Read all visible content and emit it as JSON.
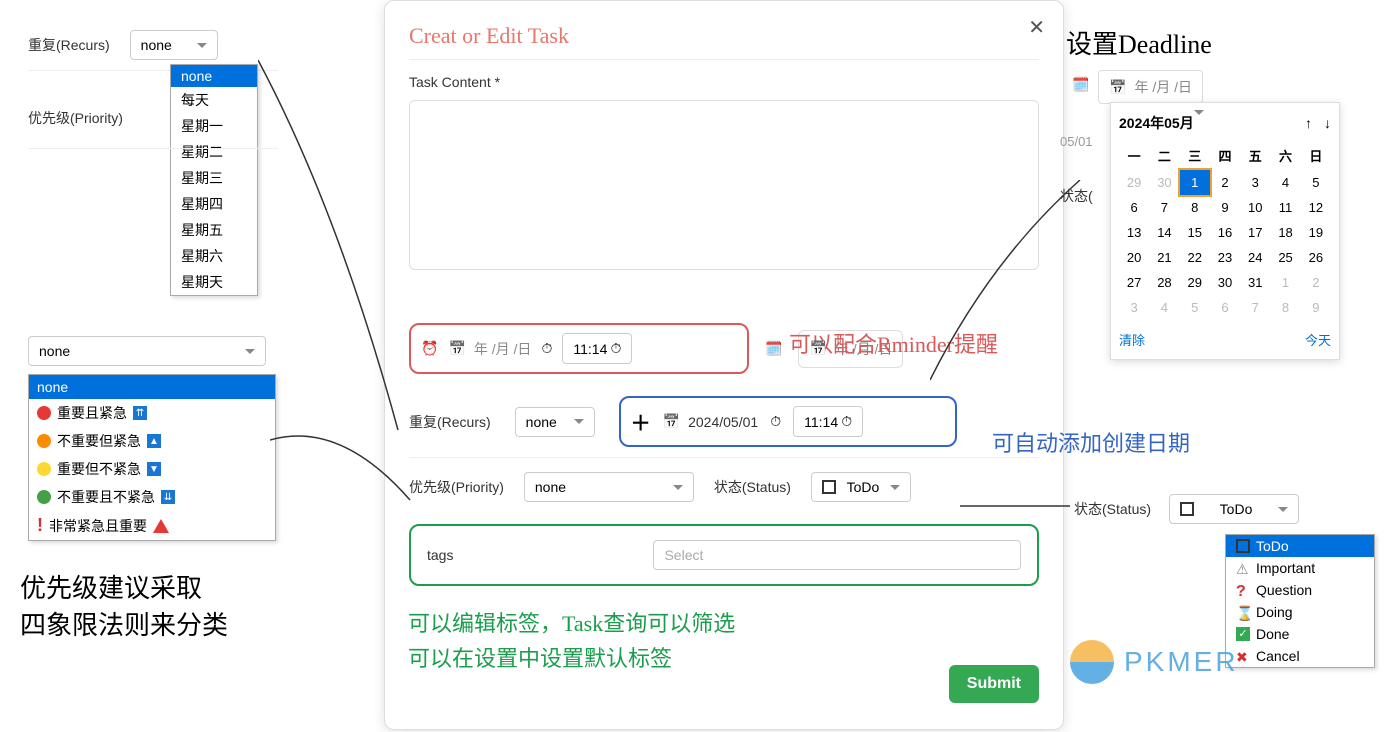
{
  "recurs": {
    "label": "重复(Recurs)",
    "selected": "none",
    "items": [
      "none",
      "每天",
      "星期一",
      "星期二",
      "星期三",
      "星期四",
      "星期五",
      "星期六",
      "星期天"
    ]
  },
  "priority_label_left": "优先级(Priority)",
  "priority": {
    "selected": "none",
    "items": [
      {
        "label": "none"
      },
      {
        "label": "重要且紧急",
        "color": "#e53935",
        "arrow": "⇈"
      },
      {
        "label": "不重要但紧急",
        "color": "#fb8c00",
        "arrow": "▲"
      },
      {
        "label": "重要但不紧急",
        "color": "#fdd835",
        "arrow": "▼"
      },
      {
        "label": "不重要且不紧急",
        "color": "#43a047",
        "arrow": "⇊"
      },
      {
        "label": "非常紧急且重要",
        "color": "",
        "arrow": ""
      }
    ]
  },
  "priority_note_l1": "优先级建议采取",
  "priority_note_l2": "四象限法则来分类",
  "dialog": {
    "title": "Creat or Edit Task",
    "content_label": "Task Content *",
    "reminder": {
      "date_ph": "年 /月 /日",
      "time": "11:14"
    },
    "deadline_inline": {
      "date_ph": "年 /月 /日"
    },
    "recurs": {
      "label": "重复(Recurs)",
      "selected": "none"
    },
    "created": {
      "date": "2024/05/01",
      "time": "11:14"
    },
    "priority": {
      "label": "优先级(Priority)",
      "selected": "none"
    },
    "status": {
      "label": "状态(Status)",
      "selected": "ToDo"
    },
    "tags": {
      "label": "tags",
      "placeholder": "Select"
    },
    "submit": "Submit"
  },
  "annotations": {
    "reminder": "可以配合Rminder提醒",
    "created": "可自动添加创建日期",
    "tags_l1": "可以编辑标签，Task查询可以筛选",
    "tags_l2": "可以在设置中设置默认标签"
  },
  "deadline": {
    "title": "设置Deadline",
    "input_ph": "年 /月 /日",
    "month": "2024年05月",
    "dow": [
      "一",
      "二",
      "三",
      "四",
      "五",
      "六",
      "日"
    ],
    "grid": [
      [
        {
          "d": 29,
          "dim": 1
        },
        {
          "d": 30,
          "dim": 1
        },
        {
          "d": 1,
          "today": 1
        },
        {
          "d": 2
        },
        {
          "d": 3
        },
        {
          "d": 4
        },
        {
          "d": 5
        }
      ],
      [
        {
          "d": 6
        },
        {
          "d": 7
        },
        {
          "d": 8
        },
        {
          "d": 9
        },
        {
          "d": 10
        },
        {
          "d": 11
        },
        {
          "d": 12
        }
      ],
      [
        {
          "d": 13
        },
        {
          "d": 14
        },
        {
          "d": 15
        },
        {
          "d": 16
        },
        {
          "d": 17
        },
        {
          "d": 18
        },
        {
          "d": 19
        }
      ],
      [
        {
          "d": 20
        },
        {
          "d": 21
        },
        {
          "d": 22
        },
        {
          "d": 23
        },
        {
          "d": 24
        },
        {
          "d": 25
        },
        {
          "d": 26
        }
      ],
      [
        {
          "d": 27
        },
        {
          "d": 28
        },
        {
          "d": 29
        },
        {
          "d": 30
        },
        {
          "d": 31
        },
        {
          "d": 1,
          "dim": 1
        },
        {
          "d": 2,
          "dim": 1
        }
      ],
      [
        {
          "d": 3,
          "dim": 1
        },
        {
          "d": 4,
          "dim": 1
        },
        {
          "d": 5,
          "dim": 1
        },
        {
          "d": 6,
          "dim": 1
        },
        {
          "d": 7,
          "dim": 1
        },
        {
          "d": 8,
          "dim": 1
        },
        {
          "d": 9,
          "dim": 1
        }
      ]
    ],
    "clear": "清除",
    "today": "今天",
    "mini_date": "05/01",
    "mini_status": "状态("
  },
  "status": {
    "label": "状态(Status)",
    "selected": "ToDo",
    "items": [
      "ToDo",
      "Important",
      "Question",
      "Doing",
      "Done",
      "Cancel"
    ]
  },
  "logo": "PKMER"
}
